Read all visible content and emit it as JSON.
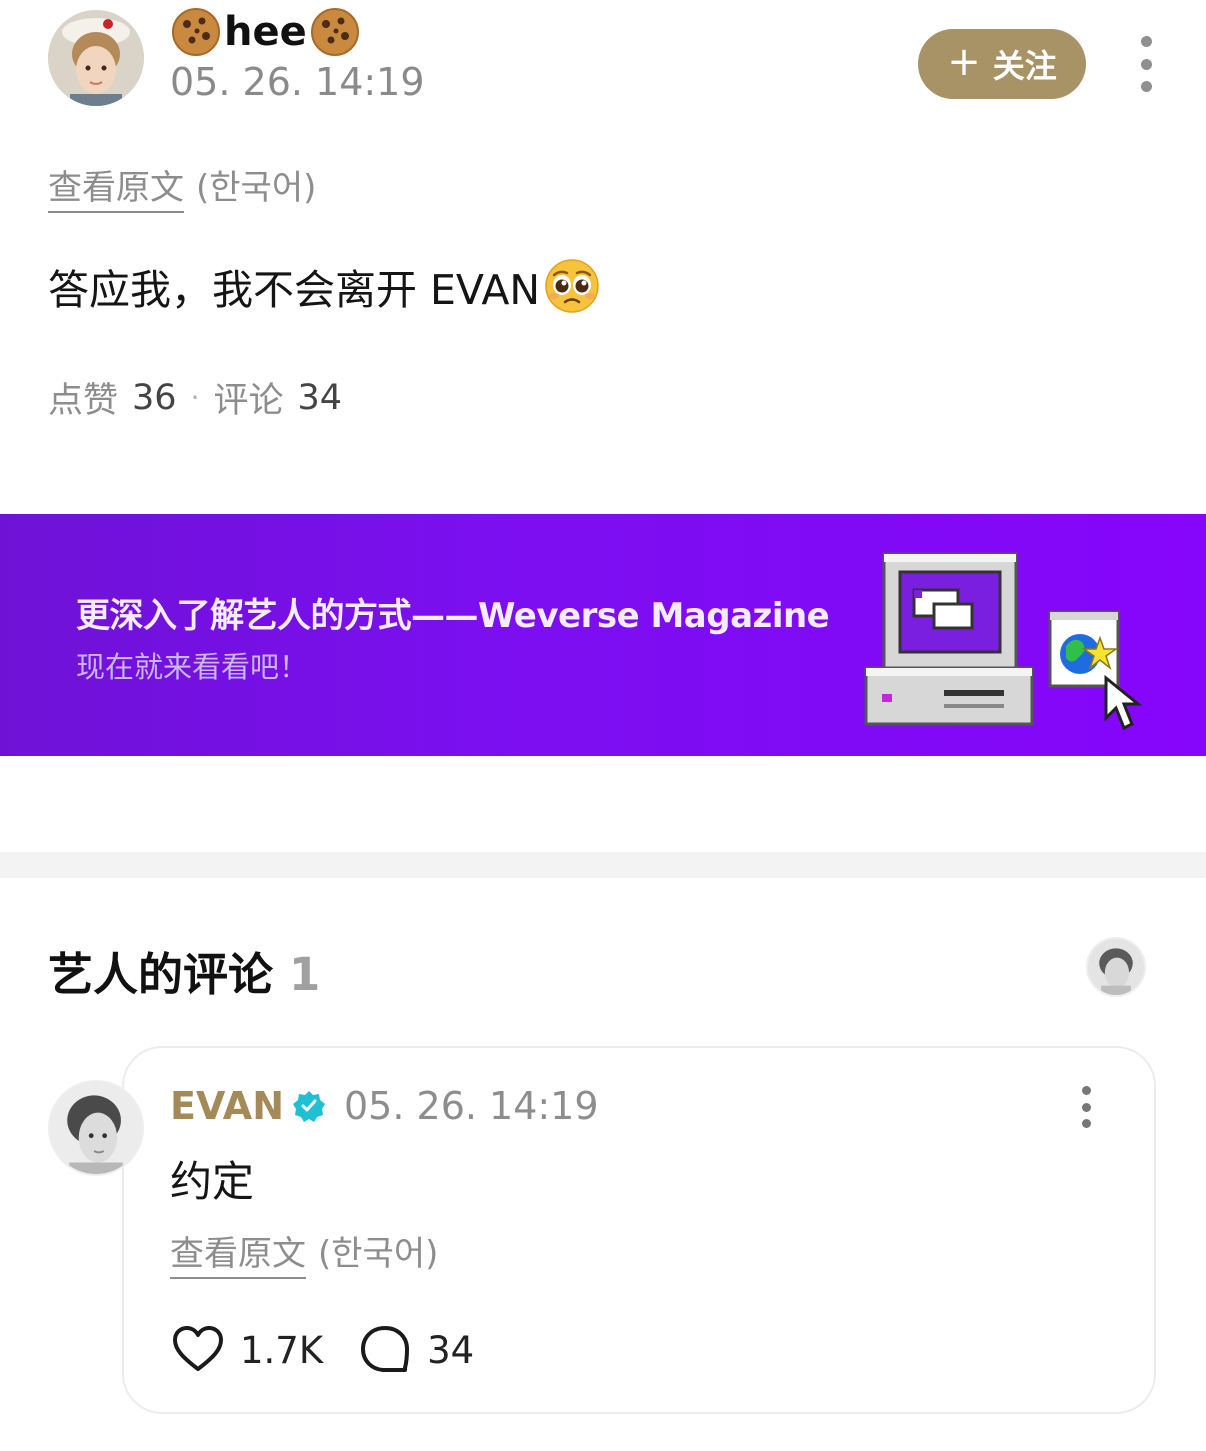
{
  "post": {
    "author_name": "hee",
    "time": "05. 26. 14:19",
    "follow_label": "关注",
    "translate_link": "查看原文",
    "translate_lang": "(한국어)",
    "body": "答应我，我不会离开 EVAN",
    "likes_label": "点赞",
    "likes_count": "36",
    "comments_label": "评论",
    "comments_count": "34"
  },
  "banner": {
    "title": "更深入了解艺人的方式——Weverse Magazine",
    "subtitle": "现在就来看看吧！"
  },
  "artist_comments": {
    "title": "艺人的评论",
    "count": "1"
  },
  "comment": {
    "author": "EVAN",
    "time": "05. 26. 14:19",
    "body": "约定",
    "translate_link": "查看原文",
    "translate_lang": "(한국어)",
    "likes": "1.7K",
    "replies": "34"
  },
  "colors": {
    "accent_gold": "#a89367",
    "banner_purple": "#8605fb",
    "verified_teal": "#1fc0d3"
  },
  "icons": [
    "cookie-icon",
    "plus-icon",
    "more-vertical-icon",
    "pleading-face-icon",
    "computer-illustration",
    "verified-badge-icon",
    "heart-icon",
    "comment-bubble-icon"
  ]
}
